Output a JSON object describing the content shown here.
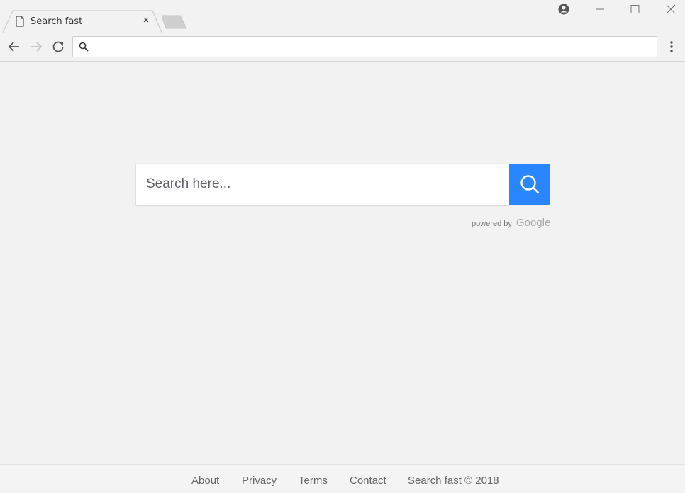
{
  "browser": {
    "tab": {
      "title": "Search fast",
      "close_label": "×",
      "icon": "page-icon"
    },
    "new_tab_icon": "new-tab-icon",
    "window_controls": {
      "profile_icon": "account-circle-icon",
      "minimize_icon": "minimize-icon",
      "maximize_icon": "maximize-icon",
      "close_icon": "close-icon"
    },
    "toolbar": {
      "back_icon": "arrow-left-icon",
      "forward_icon": "arrow-right-icon",
      "reload_icon": "reload-icon",
      "menu_icon": "more-vert-icon"
    },
    "omnibox": {
      "value": "",
      "placeholder": "",
      "icon": "search-icon"
    }
  },
  "page": {
    "search": {
      "placeholder": "Search here...",
      "value": "",
      "button_icon": "search-icon",
      "accent": "#2a86ff"
    },
    "powered_by": {
      "label": "powered by",
      "brand": "Google"
    },
    "footer": {
      "links": [
        {
          "label": "About"
        },
        {
          "label": "Privacy"
        },
        {
          "label": "Terms"
        },
        {
          "label": "Contact"
        }
      ],
      "copyright": "Search fast © 2018"
    }
  }
}
